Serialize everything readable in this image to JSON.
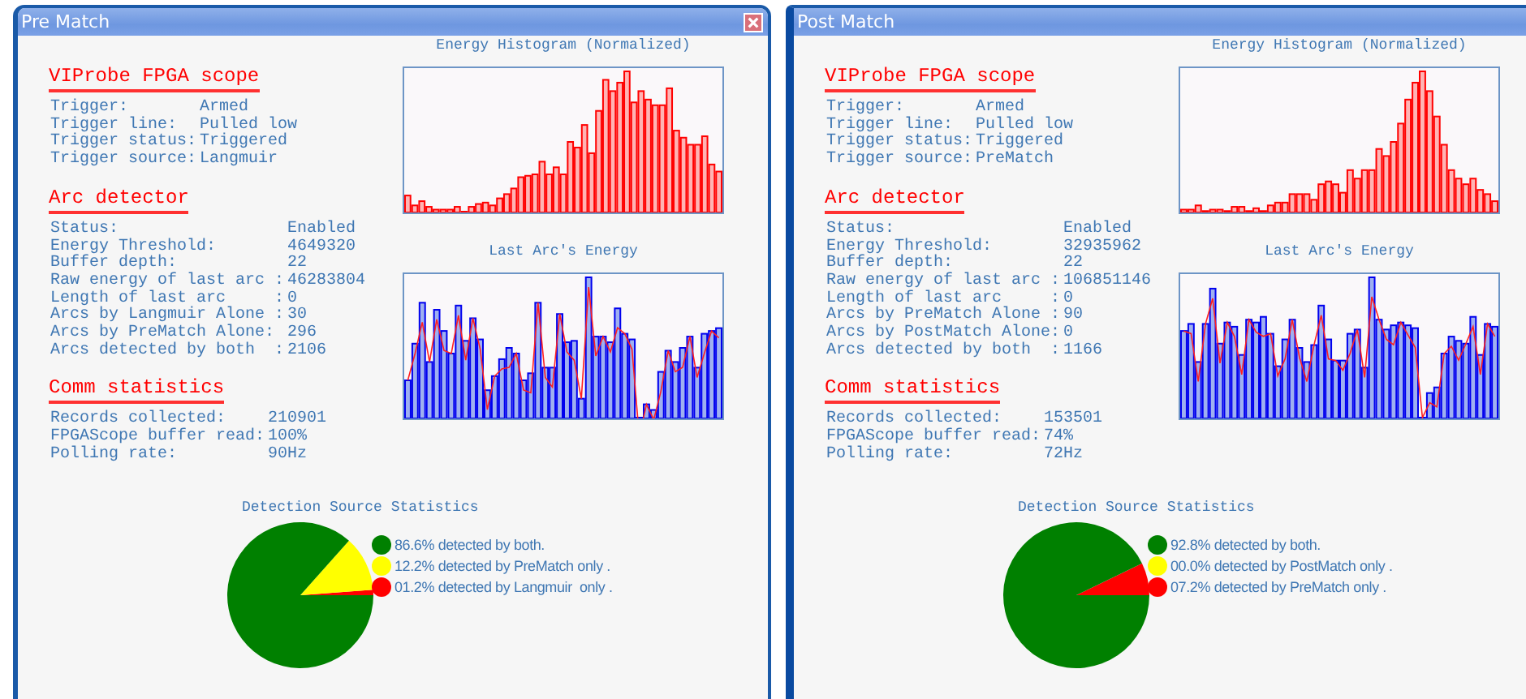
{
  "windows": [
    {
      "title": "Pre Match",
      "close_button": true,
      "sections": [
        {
          "heading": "VIProbe FPGA scope",
          "rows": [
            {
              "label": "Trigger:",
              "value": "Armed"
            },
            {
              "label": "Trigger line:",
              "value": "Pulled low"
            },
            {
              "label": "Trigger status:",
              "value": "Triggered"
            },
            {
              "label": "Trigger source:",
              "value": "Langmuir"
            }
          ]
        },
        {
          "heading": "Arc detector",
          "rows": [
            {
              "label": "Status:",
              "value": "Enabled"
            },
            {
              "label": "Energy Threshold:",
              "value": "4649320"
            },
            {
              "label": "Buffer depth:",
              "value": "22"
            },
            {
              "label": "Raw energy of last arc :",
              "value": "46283804"
            },
            {
              "label": "Length of last arc     :",
              "value": "0"
            },
            {
              "label": "Arcs by Langmuir Alone :",
              "value": "30"
            },
            {
              "label": "Arcs by PreMatch Alone:",
              "value": "296"
            },
            {
              "label": "Arcs detected by both  :",
              "value": "2106"
            }
          ]
        },
        {
          "heading": "Comm statistics",
          "rows": [
            {
              "label": "Records collected:",
              "value": "210901"
            },
            {
              "label": "FPGAScope buffer read:",
              "value": "100%"
            },
            {
              "label": "Polling rate:",
              "value": "90Hz"
            }
          ]
        }
      ],
      "histogram": {
        "title": "Energy Histogram (Normalized)"
      },
      "arc_chart": {
        "title": "Last Arc's Energy"
      },
      "detection": {
        "chart_data": {
          "type": "pie",
          "title": "Detection Source Statistics",
          "categories": [
            "86.6% detected by both.",
            "12.2% detected by PreMatch only .",
            "01.2% detected by Langmuir  only ."
          ],
          "values": [
            86.6,
            12.2,
            1.2
          ],
          "legend": true,
          "colors": [
            "#008000",
            "#ffff00",
            "#ff0000"
          ]
        }
      }
    },
    {
      "title": "Post Match",
      "sections": [
        {
          "heading": "VIProbe FPGA scope",
          "rows": [
            {
              "label": "Trigger:",
              "value": "Armed"
            },
            {
              "label": "Trigger line:",
              "value": "Pulled low"
            },
            {
              "label": "Trigger status:",
              "value": "Triggered"
            },
            {
              "label": "Trigger source:",
              "value": "PreMatch"
            }
          ]
        },
        {
          "heading": "Arc detector",
          "rows": [
            {
              "label": "Status:",
              "value": "Enabled"
            },
            {
              "label": "Energy Threshold:",
              "value": "32935962"
            },
            {
              "label": "Buffer depth:",
              "value": "22"
            },
            {
              "label": "Raw energy of last arc :",
              "value": "106851146"
            },
            {
              "label": "Length of last arc     :",
              "value": "0"
            },
            {
              "label": "Arcs by PreMatch Alone :",
              "value": "90"
            },
            {
              "label": "Arcs by PostMatch Alone:",
              "value": "0"
            },
            {
              "label": "Arcs detected by both  :",
              "value": "1166"
            }
          ]
        },
        {
          "heading": "Comm statistics",
          "rows": [
            {
              "label": "Records collected:",
              "value": "153501"
            },
            {
              "label": "FPGAScope buffer read:",
              "value": "74%"
            },
            {
              "label": "Polling rate:",
              "value": "72Hz"
            }
          ]
        }
      ],
      "histogram": {
        "title": "Energy Histogram (Normalized)"
      },
      "arc_chart": {
        "title": "Last Arc's Energy"
      },
      "detection": {
        "chart_data": {
          "type": "pie",
          "title": "Detection Source Statistics",
          "categories": [
            "92.8% detected by both.",
            "00.0% detected by PostMatch only .",
            "07.2% detected by PreMatch only ."
          ],
          "values": [
            92.8,
            0,
            7.2
          ],
          "legend": true,
          "colors": [
            "#008000",
            "#ffff00",
            "#ff0000"
          ]
        }
      }
    }
  ]
}
